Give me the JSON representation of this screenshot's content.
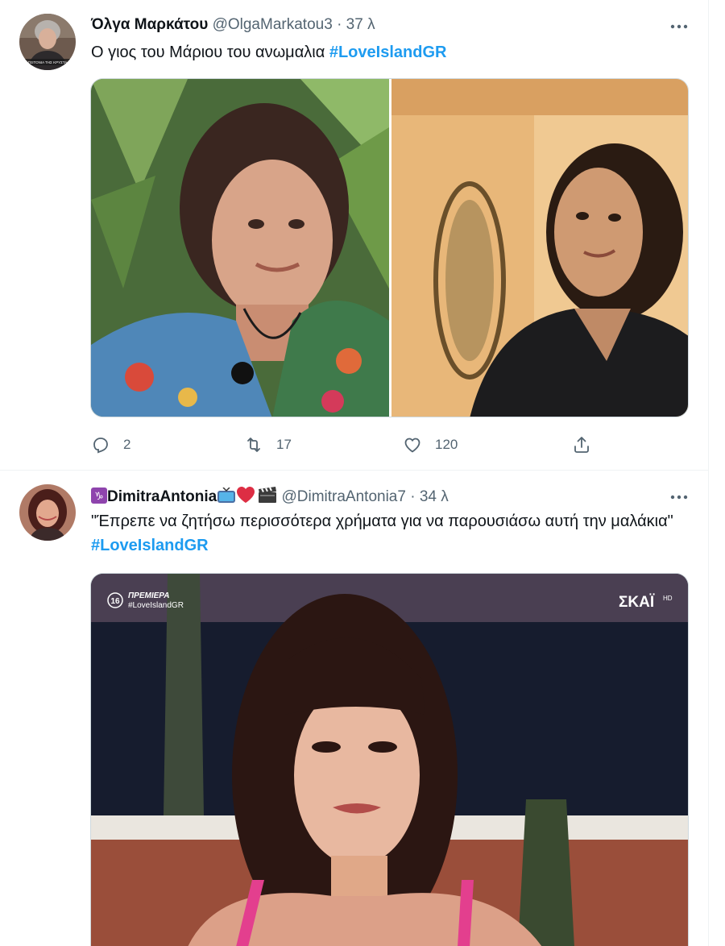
{
  "tweets": [
    {
      "author_name": "Όλγα Μαρκάτου",
      "author_handle": "@OlgaMarkatou3",
      "separator": "·",
      "time": "37 λ",
      "text_plain": "Ο γιος του Μάριου του ανωμαλια ",
      "hashtag": "#LoveIslandGR",
      "avatar_caption": "ΓΕΙΤΟΝΙΑ ΤΗΣ ΚΡΥΣΤΑ",
      "replies": "2",
      "retweets": "17",
      "likes": "120"
    },
    {
      "name_prefix_emoji": "♑",
      "author_name": "DimitraAntonia",
      "name_suffix_emojis": [
        "📺",
        "❤️",
        "🎬"
      ],
      "author_handle": "@DimitraAntonia7",
      "separator": "·",
      "time": "34 λ",
      "text_plain": "\"Έπρεπε να ζητήσω περισσότερα χρήματα για να παρουσιάσω αυτή την μαλάκια\" ",
      "hashtag": "#LoveIslandGR",
      "video_overlay": {
        "rating": "16",
        "premiere": "ΠΡΕΜΙΕΡΑ",
        "tag": "#LoveIslandGR",
        "channel": "ΣΚΑΪ",
        "quality": "HD"
      }
    }
  ],
  "icons": [
    "more-icon",
    "reply-icon",
    "retweet-icon",
    "like-icon",
    "share-icon"
  ],
  "colors": {
    "text": "#0f1419",
    "secondary": "#536471",
    "hashtag": "#1d9bf0",
    "border": "#eff3f4"
  }
}
